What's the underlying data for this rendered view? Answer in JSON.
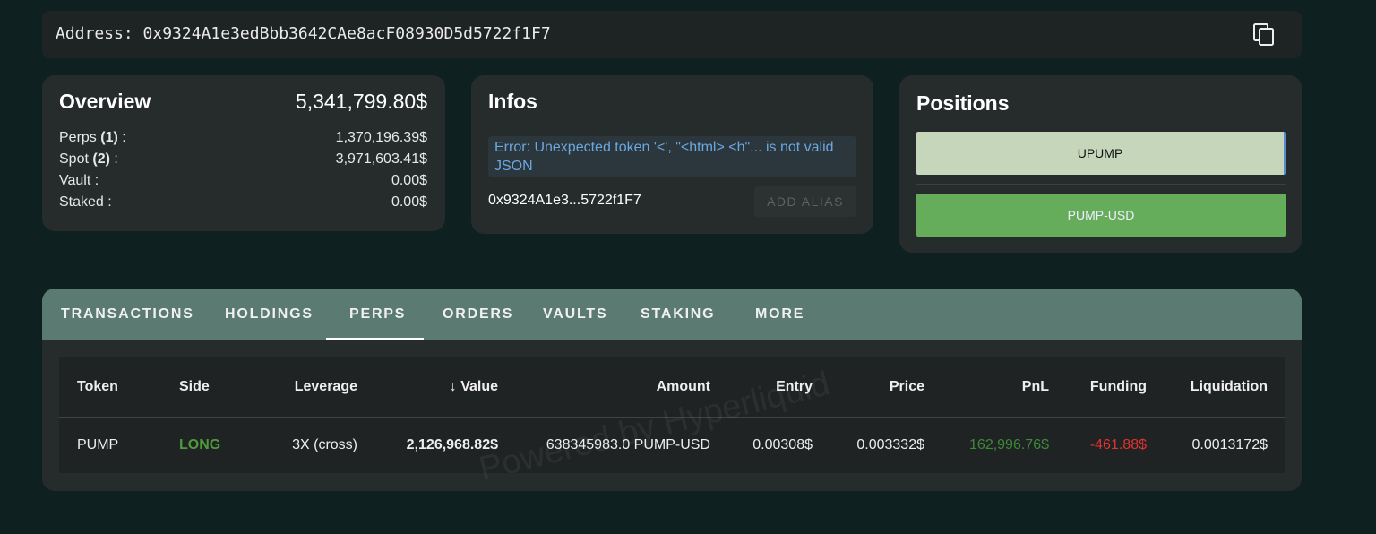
{
  "address": {
    "label": "Address: 0x9324A1e3edBbb3642CAe8acF08930D5d5722f1F7"
  },
  "overview": {
    "title": "Overview",
    "total": "5,341,799.80$",
    "rows": [
      {
        "label": "Perps",
        "count": "(1)",
        "suffix": " :",
        "value": "1,370,196.39$"
      },
      {
        "label": "Spot",
        "count": "(2)",
        "suffix": " :",
        "value": "3,971,603.41$"
      },
      {
        "label": "Vault :",
        "count": "",
        "suffix": "",
        "value": "0.00$"
      },
      {
        "label": "Staked :",
        "count": "",
        "suffix": "",
        "value": "0.00$"
      }
    ]
  },
  "infos": {
    "title": "Infos",
    "error": "Error: Unexpected token '<', \"<html> <h\"... is not valid JSON",
    "short_address": "0x9324A1e3...5722f1F7",
    "add_alias": "ADD ALIAS"
  },
  "positions": {
    "title": "Positions",
    "items": [
      "UPUMP",
      "PUMP-USD"
    ]
  },
  "tabs": [
    "TRANSACTIONS",
    "HOLDINGS",
    "PERPS",
    "ORDERS",
    "VAULTS",
    "STAKING",
    "MORE"
  ],
  "active_tab": "PERPS",
  "table": {
    "headers": [
      "Token",
      "Side",
      "Leverage",
      "Value",
      "Amount",
      "Entry",
      "Price",
      "PnL",
      "Funding",
      "Liquidation"
    ],
    "rows": [
      [
        "PUMP",
        "LONG",
        "3X (cross)",
        "2,126,968.82$",
        "638345983.0 PUMP-USD",
        "0.00308$",
        "0.003332$",
        "162,996.76$",
        "-461.88$",
        "0.0013172$"
      ]
    ]
  },
  "watermark": "Powered by Hyperliquid",
  "colors": {
    "long": "#4f9a3c",
    "pnl": "#3f8a36",
    "funding": "#e0332d",
    "tabbar": "#5a7a72"
  }
}
